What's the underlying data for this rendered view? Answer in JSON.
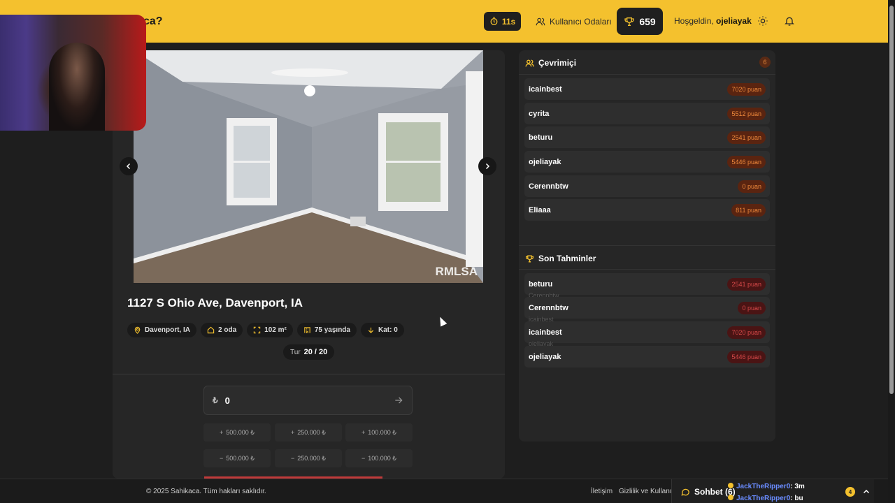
{
  "header": {
    "brand": "ca?",
    "timer": "11s",
    "rooms_label": "Kullanıcı Odaları",
    "score": "659",
    "greeting_prefix": "Hoşgeldin,",
    "username": "ojeliayak",
    "accent_color": "#f4c12e"
  },
  "listing": {
    "photo_watermark": "RMLSA",
    "address": "1127 S Ohio Ave, Davenport, IA",
    "chips": [
      {
        "icon": "location-pin-icon",
        "label": "Davenport, IA"
      },
      {
        "icon": "house-icon",
        "label": "2 oda"
      },
      {
        "icon": "expand-icon",
        "label": "102 m²"
      },
      {
        "icon": "building-icon",
        "label": "75 yaşında"
      },
      {
        "icon": "arrow-down-icon",
        "label": "Kat: 0"
      }
    ],
    "round_prefix": "Tur",
    "round_value": "20 / 20"
  },
  "guess": {
    "currency": "₺",
    "value": "0",
    "increments": [
      "500.000 ₺",
      "250.000 ₺",
      "100.000 ₺"
    ],
    "decrements": [
      "500.000 ₺",
      "250.000 ₺",
      "100.000 ₺"
    ]
  },
  "online": {
    "title": "Çevrimiçi",
    "count": "6",
    "users": [
      {
        "name": "icainbest",
        "points": "7020 puan"
      },
      {
        "name": "cyrita",
        "points": "5512 puan"
      },
      {
        "name": "beturu",
        "points": "2541 puan"
      },
      {
        "name": "ojeliayak",
        "points": "5446 puan"
      },
      {
        "name": "Cerennbtw",
        "points": "0 puan"
      },
      {
        "name": "Eliaaa",
        "points": "811 puan"
      }
    ]
  },
  "recent": {
    "title": "Son Tahminler",
    "items": [
      {
        "name": "beturu",
        "points": "2541 puan",
        "ghost": "Cerennbtw"
      },
      {
        "name": "Cerennbtw",
        "points": "0 puan",
        "ghost": "icainbest"
      },
      {
        "name": "icainbest",
        "points": "7020 puan",
        "ghost": "ojeliayak"
      },
      {
        "name": "ojeliayak",
        "points": "5446 puan",
        "ghost": ""
      }
    ]
  },
  "footer": {
    "copyright": "© 2025 Sahikaca. Tüm hakları saklıdır.",
    "contact": "İletişim",
    "privacy": "Gizlilik ve Kullanım",
    "chat_label": "Sohbet (6)",
    "chat_badge": "4",
    "ticker": [
      {
        "user": "JackTheRipper0",
        "msg": ": 3m"
      },
      {
        "user": "JackTheRipper0",
        "msg": ": bu"
      }
    ]
  }
}
